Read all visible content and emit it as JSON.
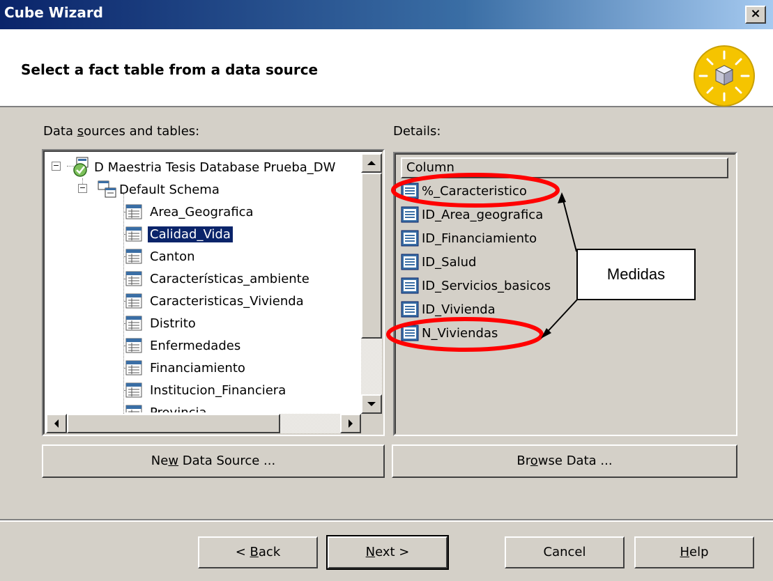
{
  "window": {
    "title": "Cube Wizard",
    "close_glyph": "×"
  },
  "header": {
    "heading": "Select a fact table from a data source",
    "icon": "cube-wizard-icon"
  },
  "left": {
    "label_pre": "Data ",
    "label_acc": "s",
    "label_post": "ources and tables:",
    "tree": {
      "root": "D  Maestria Tesis Database Prueba_DW",
      "schema": "Default Schema",
      "tables": [
        "Area_Geografica",
        "Calidad_Vida",
        "Canton",
        "Características_ambiente",
        "Caracteristicas_Vivienda",
        "Distrito",
        "Enfermedades",
        "Financiamiento",
        "Institucion_Financiera",
        "Provincia"
      ],
      "selected_index": 1
    },
    "new_source_pre": "Ne",
    "new_source_acc": "w",
    "new_source_post": " Data Source ..."
  },
  "right": {
    "label": "Details:",
    "column_header": "Column",
    "columns": [
      "%_Caracteristico",
      "ID_Area_geografica",
      "ID_Financiamiento",
      "ID_Salud",
      "ID_Servicios_basicos",
      "ID_Vivienda",
      "N_Viviendas"
    ],
    "browse_pre": "Br",
    "browse_acc": "o",
    "browse_post": "wse Data ..."
  },
  "annotation": {
    "callout": "Medidas",
    "highlight_color": "#ff0000"
  },
  "footer": {
    "back_pre": "< ",
    "back_acc": "B",
    "back_post": "ack",
    "next_acc": "N",
    "next_post": "ext >",
    "cancel": "Cancel",
    "help_acc": "H",
    "help_post": "elp"
  },
  "colors": {
    "title_bar": "#0a246a",
    "selection": "#0a246a",
    "face": "#d4d0c8"
  }
}
